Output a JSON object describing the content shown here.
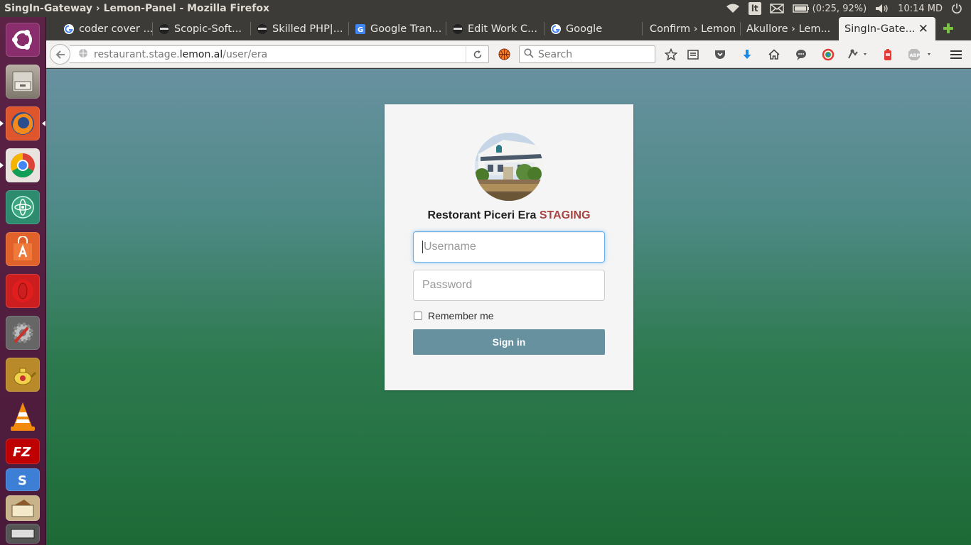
{
  "window_title": "SingIn-Gateway › Lemon-Panel - Mozilla Firefox",
  "panel": {
    "keyboard_layout": "lt",
    "battery": "(0:25, 92%)",
    "clock": "10:14 MD"
  },
  "launcher": {
    "items": [
      {
        "name": "ubuntu-dash",
        "color": "#7c2a62"
      },
      {
        "name": "files",
        "color": "#8a8174"
      },
      {
        "name": "firefox",
        "color": "#e66000"
      },
      {
        "name": "chrome",
        "color": "#4285f4"
      },
      {
        "name": "atom",
        "color": "#2d8c6e"
      },
      {
        "name": "software-center",
        "color": "#e0622a"
      },
      {
        "name": "opera",
        "color": "#d31c1c"
      },
      {
        "name": "system-settings",
        "color": "#7a7a7a"
      },
      {
        "name": "teapot-app",
        "color": "#d4a12a"
      },
      {
        "name": "vlc",
        "color": "#f08c00"
      },
      {
        "name": "filezilla",
        "color": "#bf0000"
      },
      {
        "name": "sublime-text",
        "color": "#3e7fd6"
      },
      {
        "name": "document-viewer",
        "color": "#c9b38a"
      },
      {
        "name": "scanner",
        "color": "#555555"
      }
    ]
  },
  "tabs": [
    {
      "label": "coder cover ...",
      "favicon": "google"
    },
    {
      "label": "Scopic-Soft...",
      "favicon": "ninja"
    },
    {
      "label": "Skilled PHP|...",
      "favicon": "ninja"
    },
    {
      "label": "Google Tran...",
      "favicon": "translate"
    },
    {
      "label": "Edit Work C...",
      "favicon": "ninja"
    },
    {
      "label": "Google",
      "favicon": "google"
    },
    {
      "label": "Confirm › Lemon",
      "favicon": "none"
    },
    {
      "label": "Akullore › Lem...",
      "favicon": "none"
    },
    {
      "label": "SingIn-Gate...",
      "favicon": "none",
      "active": true
    }
  ],
  "navbar": {
    "url_prefix": "restaurant.stage.",
    "url_host": "lemon.al",
    "url_path": "/user/era",
    "search_placeholder": "Search"
  },
  "login": {
    "restaurant_name": "Restorant Piceri Era",
    "env_label": "STAGING",
    "env_color": "#a94442",
    "username_placeholder": "Username",
    "password_placeholder": "Password",
    "remember_label": "Remember me",
    "remember_checked": false,
    "submit_label": "Sign in",
    "button_color": "#6891a0"
  }
}
